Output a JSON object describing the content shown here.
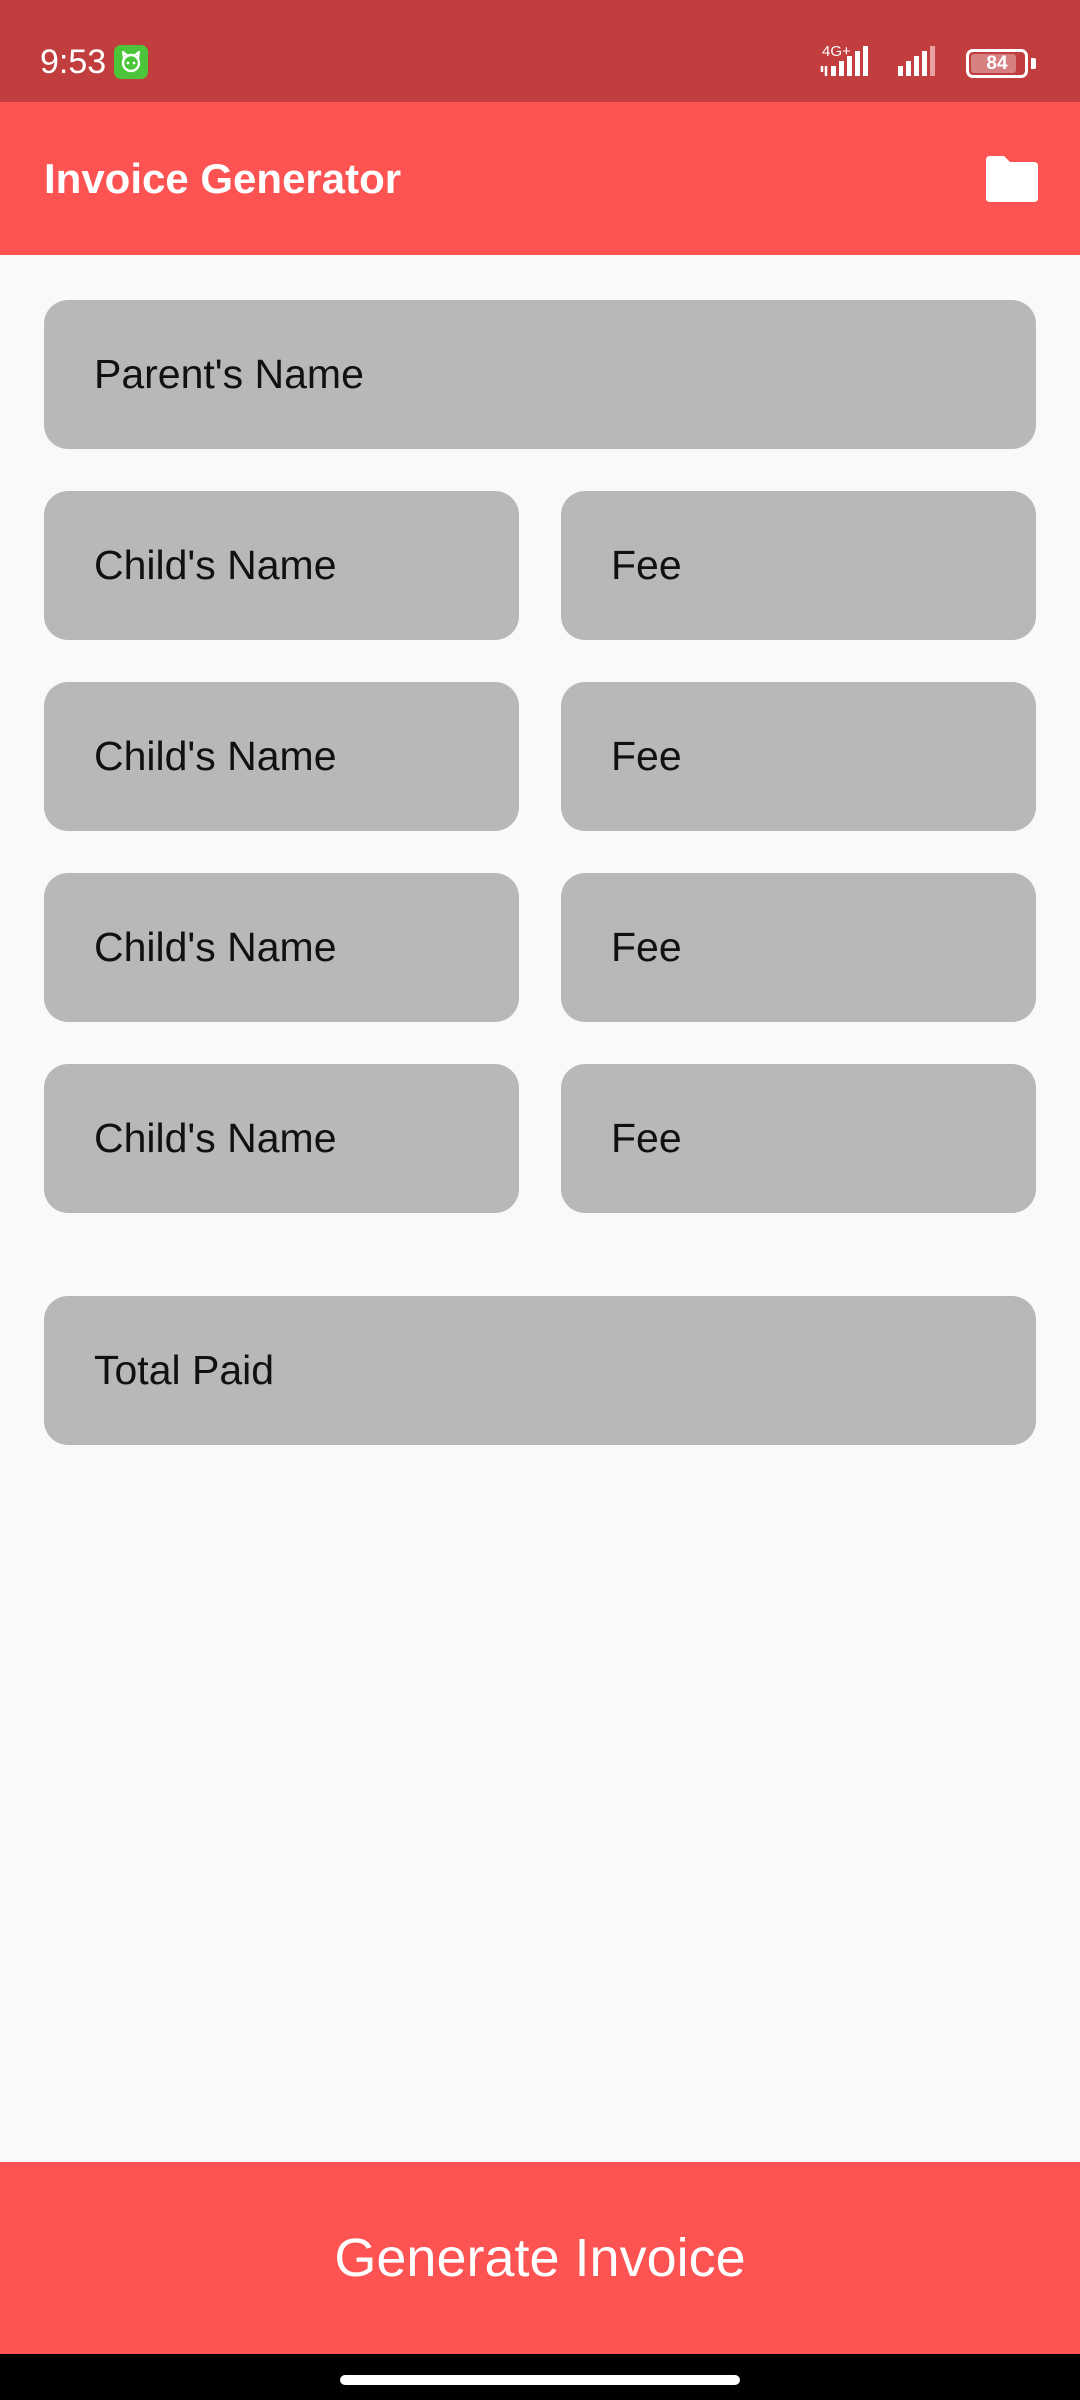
{
  "status_bar": {
    "time": "9:53",
    "network_label": "4G+",
    "battery_level": "84",
    "app_badge_icon": "android-cat-icon"
  },
  "app_bar": {
    "title": "Invoice Generator",
    "folder_icon": "folder-icon"
  },
  "form": {
    "parent_name": {
      "placeholder": "Parent's Name",
      "value": ""
    },
    "children": [
      {
        "name_placeholder": "Child's Name",
        "fee_placeholder": "Fee"
      },
      {
        "name_placeholder": "Child's Name",
        "fee_placeholder": "Fee"
      },
      {
        "name_placeholder": "Child's Name",
        "fee_placeholder": "Fee"
      },
      {
        "name_placeholder": "Child's Name",
        "fee_placeholder": "Fee"
      }
    ],
    "total_paid": {
      "placeholder": "Total Paid",
      "value": ""
    }
  },
  "actions": {
    "generate_label": "Generate Invoice"
  },
  "colors": {
    "accent": "#fe5353",
    "status_bar": "#c13d3e",
    "field_bg": "#b8b8b8",
    "page_bg": "#f9f9f9"
  }
}
